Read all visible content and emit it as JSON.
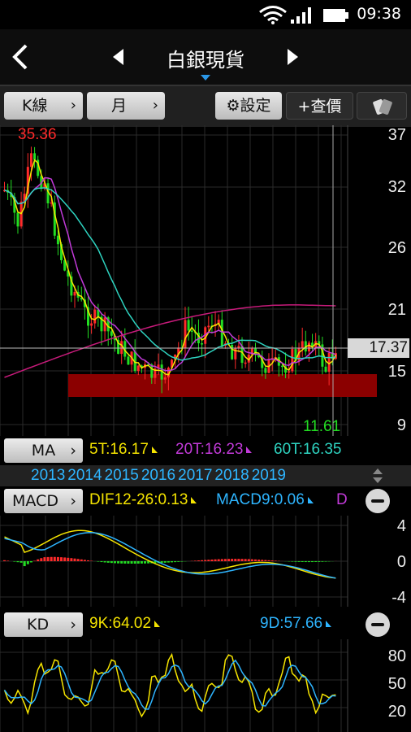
{
  "status": {
    "time": "09:38"
  },
  "nav": {
    "title": "白銀現貨"
  },
  "toolbar": {
    "kline_label": "K線",
    "period_label": "月",
    "settings_label": "設定",
    "quote_label": "+查價"
  },
  "main_chart": {
    "high_label": "35.36",
    "low_label": "11.61",
    "last_price": "17.37",
    "y_ticks": [
      "37",
      "32",
      "26",
      "21",
      "15",
      "9"
    ],
    "colors": {
      "up": "#ff2a2a",
      "down": "#22dd22",
      "ma5": "#f5e400",
      "ma20": "#c23ad9",
      "ma60": "#2ed3c0",
      "ma120": "#c81b7b"
    }
  },
  "ma_row": {
    "button": "MA",
    "ma5": "5T:16.17",
    "ma20": "20T:16.23",
    "ma60": "60T:16.35"
  },
  "years": [
    "2013",
    "2014",
    "2015",
    "2016",
    "2017",
    "2018",
    "2019"
  ],
  "macd": {
    "button": "MACD",
    "dif": "DIF12-26:0.13",
    "macd9": "MACD9:0.06",
    "osc_cut": "D",
    "y_ticks": [
      "4",
      "0",
      "-4"
    ]
  },
  "kd": {
    "button": "KD",
    "k": "9K:64.02",
    "d": "9D:57.66",
    "y_ticks": [
      "80",
      "50",
      "20"
    ]
  }
}
